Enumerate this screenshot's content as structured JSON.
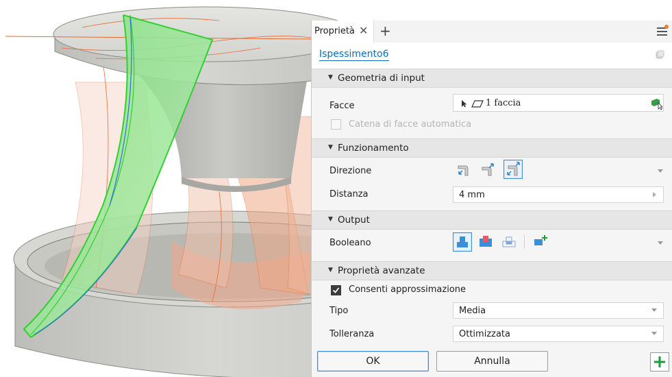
{
  "panel": {
    "tab_label": "Proprietà",
    "feature_name": "Ispessimento6",
    "sections": {
      "input_geometry": "Geometria di input",
      "behavior": "Funzionamento",
      "output": "Output",
      "advanced": "Proprietà avanzate"
    },
    "faces": {
      "label": "Facce",
      "value": "1 faccia"
    },
    "auto_chain": {
      "label": "Catena di facce automatica",
      "checked": false,
      "disabled": true
    },
    "direction": {
      "label": "Direzione",
      "selected_index": 2
    },
    "distance": {
      "label": "Distanza",
      "value": "4 mm"
    },
    "boolean": {
      "label": "Booleano",
      "selected_index": 0
    },
    "allow_approx": {
      "label": "Consenti approssimazione",
      "checked": true
    },
    "type": {
      "label": "Tipo",
      "value": "Media"
    },
    "tolerance": {
      "label": "Tolleranza",
      "value": "Ottimizzata"
    },
    "buttons": {
      "ok": "OK",
      "cancel": "Annulla"
    }
  },
  "colors": {
    "accent": "#0a6ebd",
    "selection_green": "#2fd02f",
    "sketch_orange": "#e86a2e",
    "model_gray": "#d9d9d5",
    "add_green": "#1e9b3a"
  },
  "icons": [
    "close-icon",
    "plus-icon",
    "menu-icon",
    "pin-icon",
    "cursor-arrow-icon",
    "face-icon",
    "select-faces-icon",
    "direction-side1-icon",
    "direction-side2-icon",
    "direction-symmetric-icon",
    "join-icon",
    "cut-icon",
    "intersect-icon",
    "new-body-icon",
    "add-icon"
  ]
}
